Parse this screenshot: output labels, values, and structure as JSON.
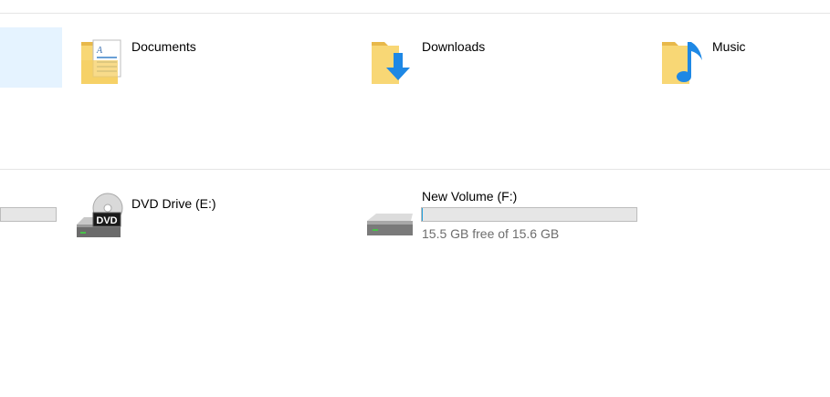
{
  "folders": [
    {
      "label": "Documents",
      "icon": "documents-folder-icon"
    },
    {
      "label": "Downloads",
      "icon": "downloads-folder-icon"
    },
    {
      "label": "Music",
      "icon": "music-folder-icon"
    }
  ],
  "drives": {
    "partial_drive": {
      "used_fraction": 0.0
    },
    "dvd": {
      "label": "DVD Drive (E:)",
      "icon": "dvd-drive-icon",
      "badge": "DVD"
    },
    "new_volume": {
      "label": "New Volume (F:)",
      "icon": "hard-drive-icon",
      "free_text": "15.5 GB free of 15.6 GB",
      "used_fraction": 0.006
    }
  },
  "colors": {
    "selection": "#e5f3ff",
    "bar_fill": "#26a0da",
    "bar_bg": "#e6e6e6",
    "folder": "#f8d775",
    "accent_blue": "#1e88e5"
  }
}
